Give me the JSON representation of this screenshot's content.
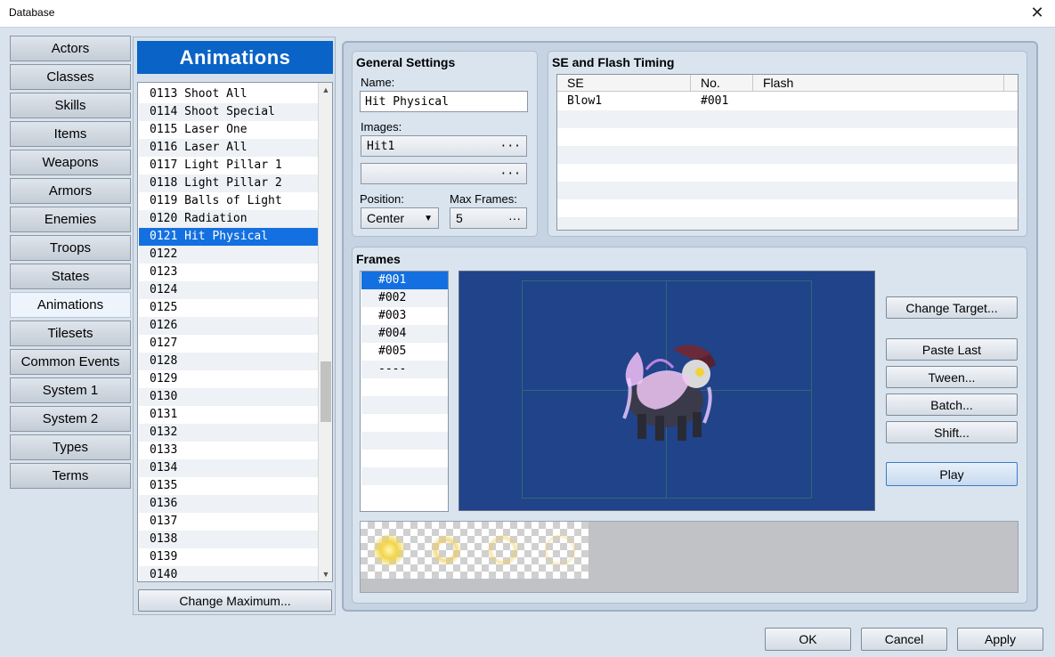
{
  "window": {
    "title": "Database",
    "close_glyph": "✕"
  },
  "categories": [
    "Actors",
    "Classes",
    "Skills",
    "Items",
    "Weapons",
    "Armors",
    "Enemies",
    "Troops",
    "States",
    "Animations",
    "Tilesets",
    "Common Events",
    "System 1",
    "System 2",
    "Types",
    "Terms"
  ],
  "active_category": "Animations",
  "list": {
    "header": "Animations",
    "items": [
      "0113 Shoot All",
      "0114 Shoot Special",
      "0115 Laser One",
      "0116 Laser All",
      "0117 Light Pillar 1",
      "0118 Light Pillar 2",
      "0119 Balls of Light",
      "0120 Radiation",
      "0121 Hit Physical",
      "0122",
      "0123",
      "0124",
      "0125",
      "0126",
      "0127",
      "0128",
      "0129",
      "0130",
      "0131",
      "0132",
      "0133",
      "0134",
      "0135",
      "0136",
      "0137",
      "0138",
      "0139",
      "0140"
    ],
    "selected_index": 8,
    "change_max_label": "Change Maximum..."
  },
  "general": {
    "title": "General Settings",
    "name_label": "Name:",
    "name_value": "Hit Physical",
    "images_label": "Images:",
    "image1": "Hit1",
    "image2": "",
    "ellipsis": "···",
    "position_label": "Position:",
    "position_value": "Center",
    "max_frames_label": "Max Frames:",
    "max_frames_value": "5"
  },
  "se_flash": {
    "title": "SE and Flash Timing",
    "columns": [
      "SE",
      "No.",
      "Flash"
    ],
    "rows": [
      {
        "se": "Blow1",
        "no": "#001",
        "flash": ""
      }
    ]
  },
  "frames": {
    "title": "Frames",
    "items": [
      "#001",
      "#002",
      "#003",
      "#004",
      "#005",
      "----"
    ],
    "selected_index": 0
  },
  "buttons": {
    "change_target": "Change Target...",
    "paste_last": "Paste Last",
    "tween": "Tween...",
    "batch": "Batch...",
    "shift": "Shift...",
    "play": "Play"
  },
  "footer": {
    "ok": "OK",
    "cancel": "Cancel",
    "apply": "Apply"
  }
}
